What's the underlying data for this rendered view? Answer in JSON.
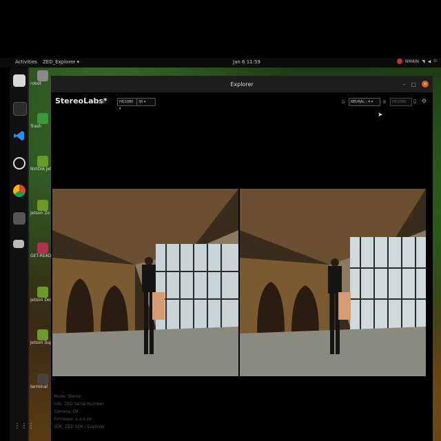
{
  "topbar": {
    "activities": "Activities",
    "app_menu": "ZED_Explorer ▾",
    "clock": "Jan 6 11:59",
    "user": "NMAIN"
  },
  "dock": {
    "items": [
      "files-icon",
      "terminal-icon",
      "vscode-icon",
      "obs-icon",
      "chrome-icon",
      "drive-icon",
      "disk-icon"
    ],
    "apps_grid": "⋮⋮⋮"
  },
  "desktop": {
    "items": [
      {
        "label": "robot"
      },
      {
        "label": "Trash"
      },
      {
        "label": "NVIDIA Jets Community"
      },
      {
        "label": "Jetson Zo"
      },
      {
        "label": "GET-READY"
      },
      {
        "label": "Jetson Developer Z"
      },
      {
        "label": "Jetson Supp Forums"
      },
      {
        "label": "terminal"
      }
    ]
  },
  "window": {
    "title": "Explorer",
    "minimize": "–",
    "maximize": "▢",
    "close": "×"
  },
  "toolbar": {
    "brand": "StereoLabs*",
    "fps_label": "Cali",
    "resolution": "HD1080 ▾",
    "fps": "30 ▾",
    "depth_label": "D",
    "depth_mode": "NEURAL  -  4   ▾",
    "b_label": "B",
    "b_input_placeholder": "HD1080"
  },
  "log": {
    "lines": [
      "Mode: Stereo",
      "Info: ZED Serial Number",
      "Camera: OK",
      "Firmware: x.x.x.xx",
      "SDK: ZED SDK / Explorer"
    ]
  }
}
